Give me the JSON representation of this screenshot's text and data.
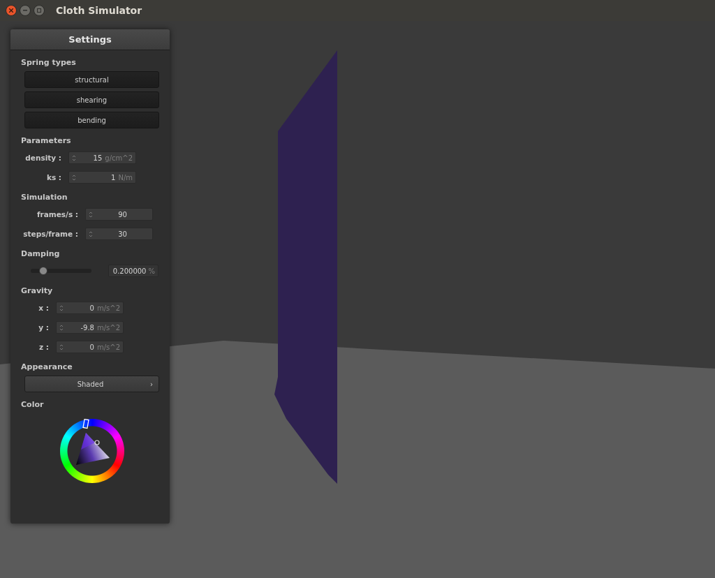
{
  "window": {
    "title": "Cloth Simulator"
  },
  "panel": {
    "title": "Settings",
    "sections": [
      {
        "kind": "buttons",
        "title": "Spring types",
        "buttons": [
          "structural",
          "shearing",
          "bending"
        ]
      },
      {
        "kind": "spinners",
        "title": "Parameters",
        "fields": [
          {
            "label": "density :",
            "value": "15",
            "unit": "g/cm^2"
          },
          {
            "label": "ks :",
            "value": "1",
            "unit": "N/m"
          }
        ]
      },
      {
        "kind": "spinners",
        "title": "Simulation",
        "fields": [
          {
            "label": "frames/s :",
            "value": "90"
          },
          {
            "label": "steps/frame :",
            "value": "30"
          }
        ]
      },
      {
        "kind": "slider",
        "title": "Damping",
        "level": 0.2,
        "value": "0.200000",
        "unit": "%"
      },
      {
        "kind": "spinners",
        "title": "Gravity",
        "fields": [
          {
            "label": "x :",
            "value": "0",
            "unit": "m/s^2"
          },
          {
            "label": "y :",
            "value": "-9.8",
            "unit": "m/s^2"
          },
          {
            "label": "z :",
            "value": "0",
            "unit": "m/s^2"
          }
        ]
      },
      {
        "kind": "dropdown",
        "title": "Appearance",
        "value": "Shaded",
        "arrow": "›"
      },
      {
        "kind": "color",
        "title": "Color"
      }
    ]
  }
}
